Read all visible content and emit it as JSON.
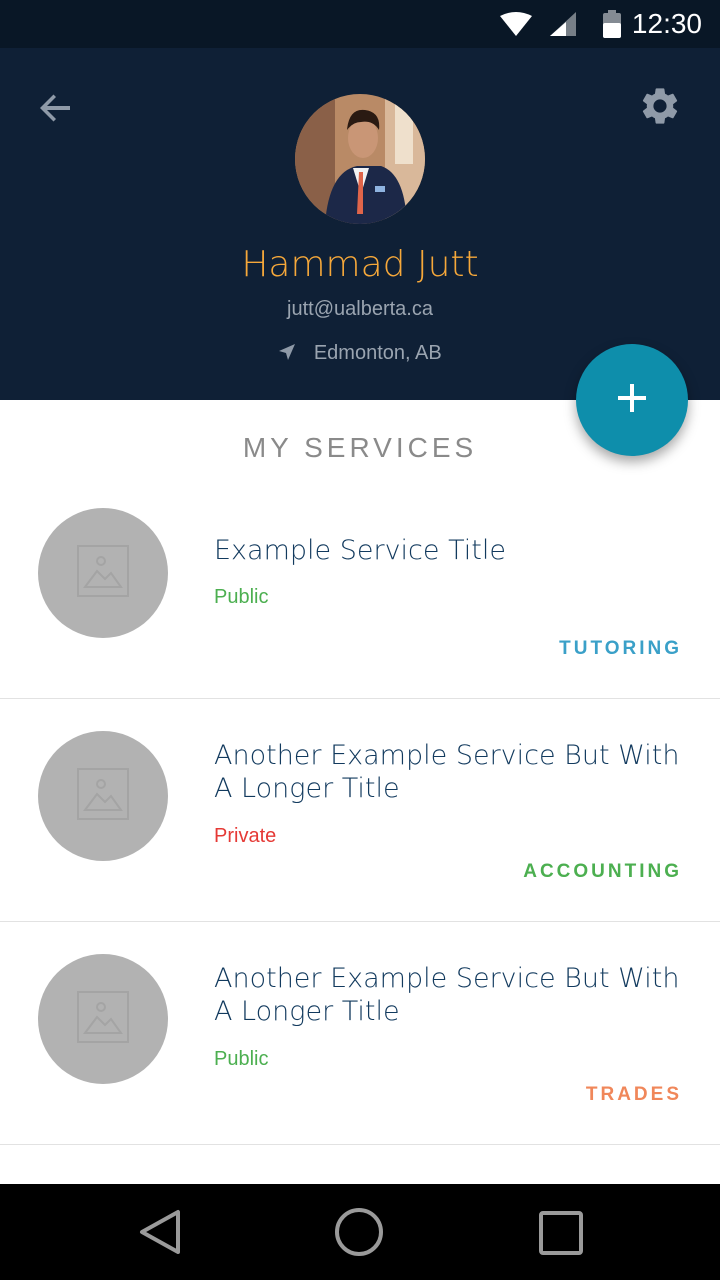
{
  "status_bar": {
    "time": "12:30",
    "icons": [
      "wifi-icon",
      "signal-icon",
      "battery-icon"
    ]
  },
  "header": {
    "back_icon": "arrow-left-icon",
    "settings_icon": "gear-icon",
    "name": "Hammad Jutt",
    "email": "jutt@ualberta.ca",
    "location": "Edmonton, AB",
    "location_icon": "navigation-arrow-icon"
  },
  "fab": {
    "icon": "plus-icon"
  },
  "section_title": "MY SERVICES",
  "services": [
    {
      "title": "Example Service Title",
      "visibility": "Public",
      "category": "TUTORING"
    },
    {
      "title": "Another Example Service But With A Longer Title",
      "visibility": "Private",
      "category": "ACCOUNTING"
    },
    {
      "title": "Another Example Service But With A Longer Title",
      "visibility": "Public",
      "category": "TRADES"
    }
  ],
  "colors": {
    "header_bg": "#0f2036",
    "status_bar_bg": "#091726",
    "name_accent": "#f6a83a",
    "fab": "#0e8eab",
    "public": "#4caf50",
    "private": "#e53935",
    "tutoring": "#3aa0c8",
    "accounting": "#4caf50",
    "trades": "#f0875a"
  },
  "nav_bar": {
    "icons": [
      "nav-back-icon",
      "nav-home-icon",
      "nav-recents-icon"
    ]
  }
}
